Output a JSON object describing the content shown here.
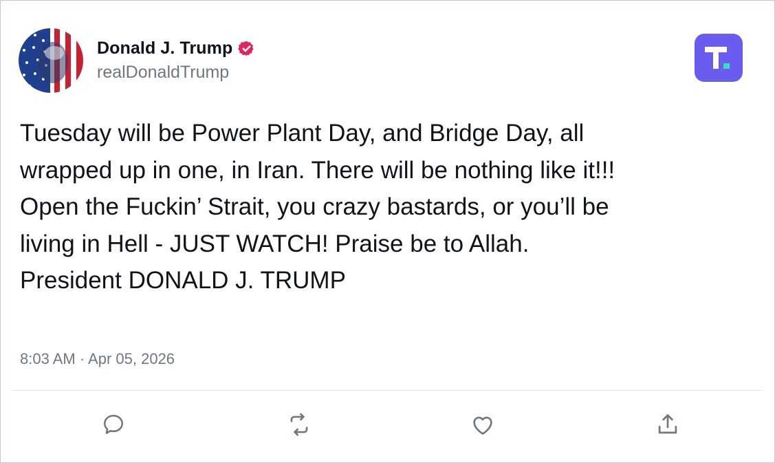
{
  "post": {
    "author": {
      "display_name": "Donald J. Trump",
      "handle": "realDonaldTrump",
      "verified": true,
      "verified_icon": "verified-badge-icon",
      "verified_color": "#e0245e",
      "avatar": "profile-avatar-american-flag"
    },
    "brand": {
      "icon": "truth-social-logo",
      "color": "#6b5cf0"
    },
    "body": "Tuesday will be Power Plant Day, and Bridge Day, all\nwrapped up in one, in Iran. There will be nothing like it!!!\nOpen the Fuckin’ Strait, you crazy bastards, or you’ll be\nliving in Hell - JUST WATCH! Praise be to Allah.\nPresident DONALD J. TRUMP",
    "timestamp": "8:03 AM · Apr 05, 2026",
    "actions": [
      {
        "icon": "reply-icon"
      },
      {
        "icon": "retruth-icon"
      },
      {
        "icon": "like-icon"
      },
      {
        "icon": "share-icon"
      }
    ]
  }
}
